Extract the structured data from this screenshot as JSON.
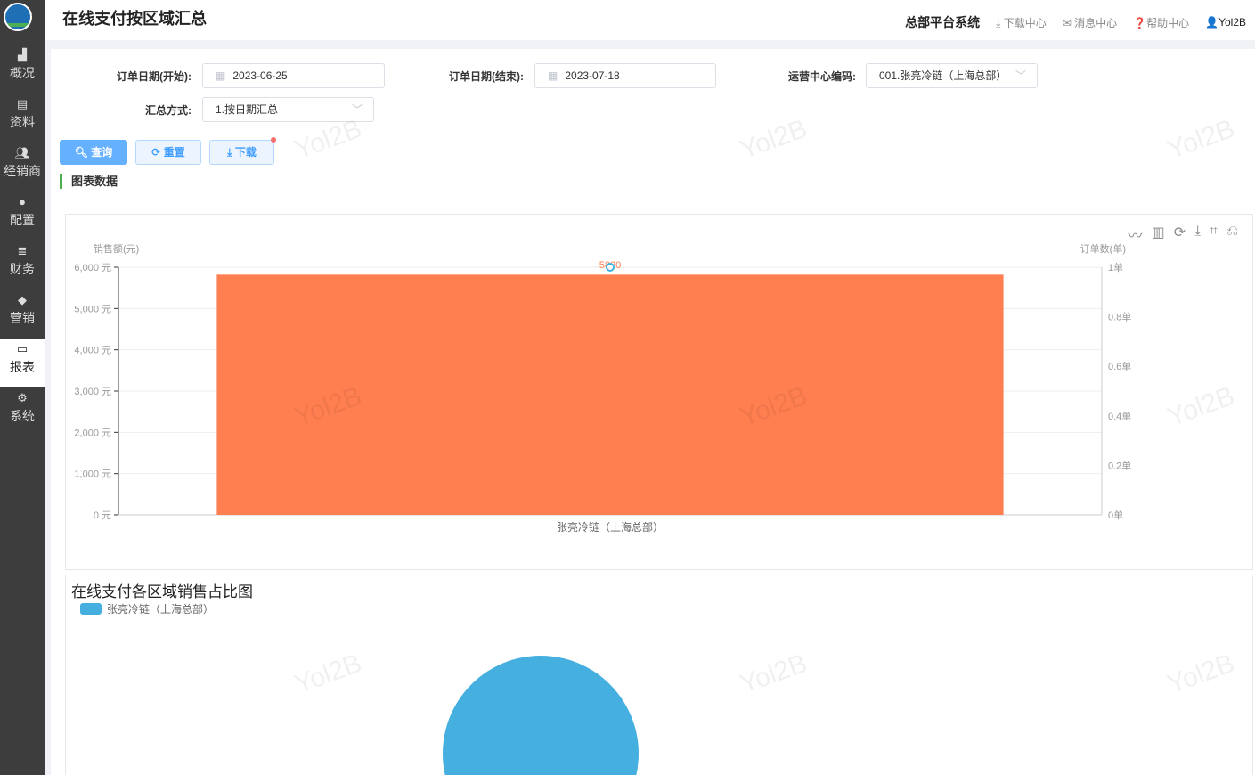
{
  "sidebar": {
    "items": [
      {
        "label": "概况",
        "icon": "building-icon"
      },
      {
        "label": "资料",
        "icon": "document-icon"
      },
      {
        "label": "经销商",
        "icon": "dealer-icon"
      },
      {
        "label": "配置",
        "icon": "config-icon"
      },
      {
        "label": "财务",
        "icon": "coins-icon"
      },
      {
        "label": "营销",
        "icon": "tag-icon"
      },
      {
        "label": "报表",
        "icon": "chart-monitor-icon",
        "active": true
      },
      {
        "label": "系统",
        "icon": "gears-icon"
      }
    ]
  },
  "header": {
    "title": "在线支付按区域汇总",
    "system": "总部平台系统",
    "download": "下载中心",
    "messages": "消息中心",
    "help": "帮助中心",
    "user": "Yol2B"
  },
  "filters": {
    "start_label": "订单日期(开始):",
    "start_value": "2023-06-25",
    "end_label": "订单日期(结束):",
    "end_value": "2023-07-18",
    "center_label": "运营中心编码:",
    "center_value": "001.张亮冷链（上海总部）",
    "mode_label": "汇总方式:",
    "mode_value": "1.按日期汇总"
  },
  "buttons": {
    "query": "查询",
    "reset": "重置",
    "download": "下载"
  },
  "section_title": "图表数据",
  "watermark": "Yol2B",
  "colors": {
    "bar": "#ff7f50",
    "line": "#3eb4e2",
    "pie": "#45b0e0"
  },
  "chart_data": [
    {
      "type": "bar",
      "ylabel": "销售额(元)",
      "y2label": "订单数(单)",
      "categories": [
        "张亮冷链（上海总部）"
      ],
      "series": [
        {
          "name": "销售额",
          "type": "bar",
          "values": [
            5820
          ]
        },
        {
          "name": "订单数",
          "type": "line",
          "axis": "right",
          "values": [
            1
          ]
        }
      ],
      "data_labels": [
        "5820"
      ],
      "yticks": [
        "0 元",
        "1,000 元",
        "2,000 元",
        "3,000 元",
        "4,000 元",
        "5,000 元",
        "6,000 元"
      ],
      "ylim": [
        0,
        6000
      ],
      "y2ticks": [
        "0单",
        "0.2单",
        "0.4单",
        "0.6单",
        "0.8单",
        "1单"
      ],
      "y2lim": [
        0,
        1
      ]
    },
    {
      "type": "pie",
      "title": "在线支付各区域销售占比图",
      "legend": [
        "张亮冷链（上海总部）"
      ],
      "values": [
        5820
      ]
    }
  ]
}
